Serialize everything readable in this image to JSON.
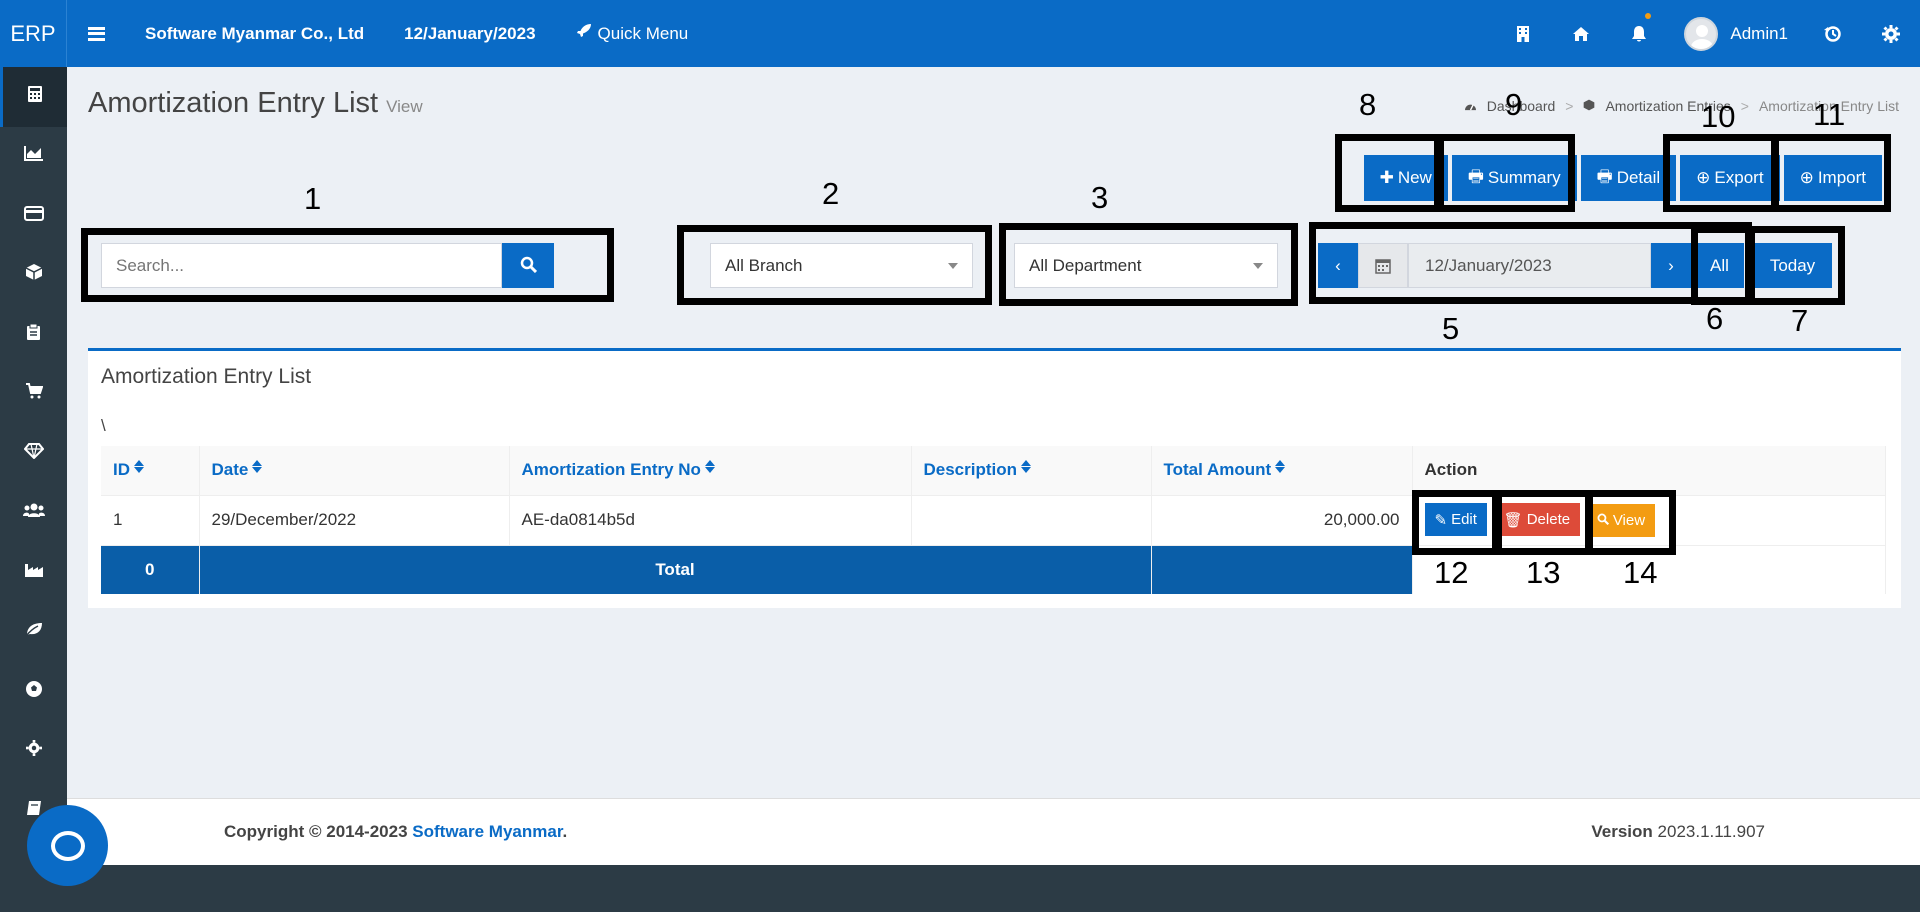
{
  "topbar": {
    "brand": "ERP",
    "company": "Software Myanmar Co., Ltd",
    "date": "12/January/2023",
    "quick_menu": "Quick Menu",
    "username": "Admin1",
    "icons": [
      "building-icon",
      "home-icon",
      "bell-icon",
      "history-icon",
      "gear-icon"
    ]
  },
  "sidebar": {
    "icons": [
      "calculator-icon",
      "area-chart-icon",
      "credit-card-icon",
      "cube-icon",
      "clipboard-icon",
      "cart-icon",
      "diamond-icon",
      "users-icon",
      "industry-icon",
      "leaf-icon",
      "soccer-ball-icon",
      "cog-icon",
      "book-icon",
      "chat-icon"
    ]
  },
  "page": {
    "title": "Amortization Entry List",
    "subtitle": "View"
  },
  "breadcrumb": {
    "items": [
      "Dashboard",
      "Amortization Entries",
      "Amortization Entry List"
    ]
  },
  "actions": {
    "new": "New",
    "summary": "Summary",
    "detail": "Detail",
    "export": "Export",
    "import": "Import"
  },
  "filters": {
    "search_placeholder": "Search...",
    "branch": "All Branch",
    "department": "All Department",
    "date": "12/January/2023",
    "all": "All",
    "today": "Today"
  },
  "list": {
    "title": "Amortization Entry List",
    "backslash": "\\",
    "columns": [
      "ID",
      "Date",
      "Amortization Entry No",
      "Description",
      "Total Amount",
      "Action"
    ],
    "rows": [
      {
        "id": "1",
        "date": "29/December/2022",
        "entry_no": "AE-da0814b5d",
        "description": "",
        "total_amount": "20,000.00"
      }
    ],
    "row_actions": {
      "edit": "Edit",
      "delete": "Delete",
      "view": "View"
    },
    "total_row": {
      "count": "0",
      "label": "Total"
    }
  },
  "footer": {
    "copyright": "Copyright © 2014-2023",
    "company_link": "Software Myanmar",
    "dot": ".",
    "version_label": "Version",
    "version": "2023.1.11.907"
  },
  "annotations": [
    "1",
    "2",
    "3",
    "5",
    "6",
    "7",
    "8",
    "9",
    "10",
    "11",
    "12",
    "13",
    "14"
  ],
  "colors": {
    "primary": "#0a6bc6",
    "sidebar": "#2c3b45",
    "delete": "#dd4b39",
    "view": "#f39c12",
    "total_row": "#0a5ea8"
  }
}
